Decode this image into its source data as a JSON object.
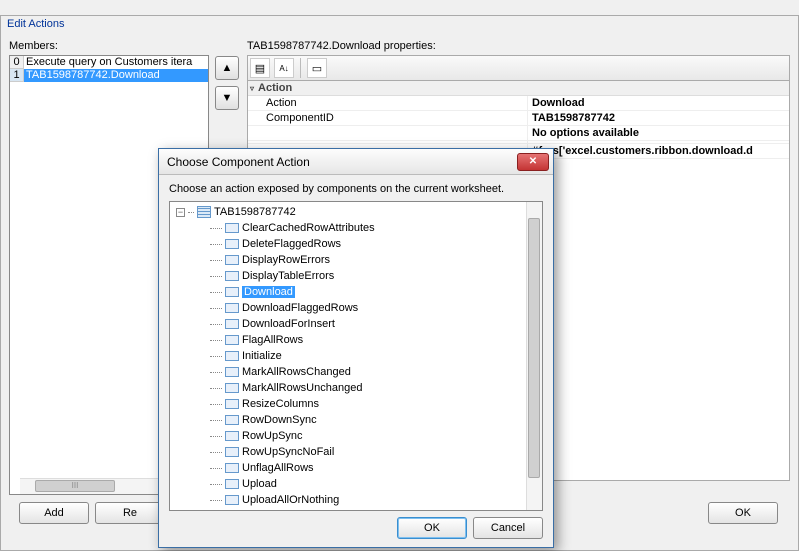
{
  "main": {
    "title": "Edit Actions",
    "members_label": "Members:",
    "properties_label": "TAB1598787742.Download properties:",
    "members": [
      {
        "index": "0",
        "text": "Execute query on Customers itera"
      },
      {
        "index": "1",
        "text": "TAB1598787742.Download"
      }
    ],
    "prop_section": "Action",
    "props": [
      {
        "key": "Action",
        "val": "Download"
      },
      {
        "key": "ComponentID",
        "val": "TAB1598787742"
      },
      {
        "key": "",
        "val": "No options available"
      },
      {
        "key": "",
        "val": ""
      },
      {
        "key": "",
        "val": "#{res['excel.customers.ribbon.download.d"
      }
    ],
    "buttons": {
      "add": "Add",
      "remove": "Re",
      "ok": "OK"
    },
    "scrollbar_thumb_hint": "III"
  },
  "dialog": {
    "title": "Choose Component Action",
    "description": "Choose an action exposed by components on the current worksheet.",
    "root": "TAB1598787742",
    "selected": "Download",
    "actions": [
      "ClearCachedRowAttributes",
      "DeleteFlaggedRows",
      "DisplayRowErrors",
      "DisplayTableErrors",
      "Download",
      "DownloadFlaggedRows",
      "DownloadForInsert",
      "FlagAllRows",
      "Initialize",
      "MarkAllRowsChanged",
      "MarkAllRowsUnchanged",
      "ResizeColumns",
      "RowDownSync",
      "RowUpSync",
      "RowUpSyncNoFail",
      "UnflagAllRows",
      "Upload",
      "UploadAllOrNothing"
    ],
    "buttons": {
      "ok": "OK",
      "cancel": "Cancel"
    }
  }
}
